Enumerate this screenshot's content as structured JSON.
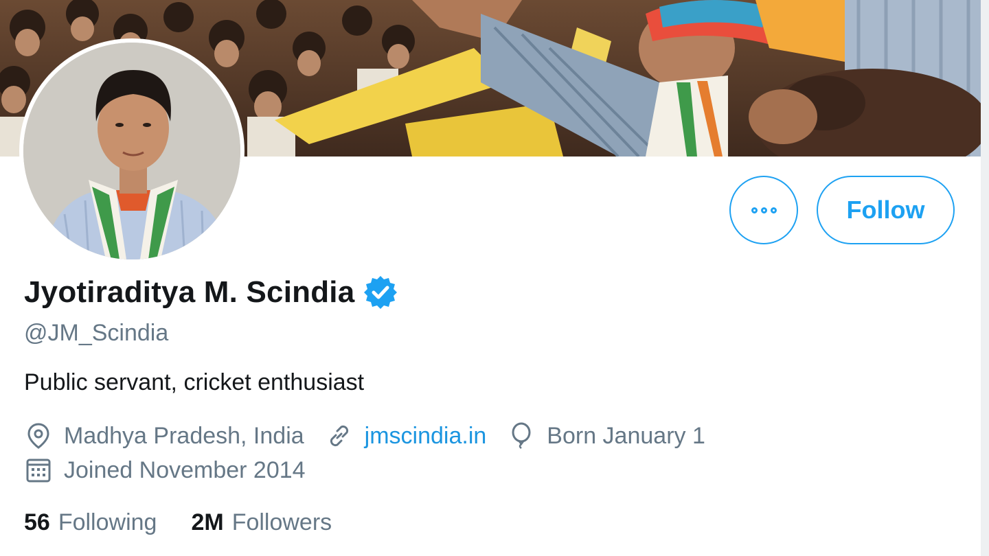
{
  "colors": {
    "accent": "#1da1f2",
    "link": "#1b95e0",
    "secondary_text": "#657786",
    "primary_text": "#14171a"
  },
  "profile": {
    "display_name": "Jyotiraditya M. Scindia",
    "handle": "@JM_Scindia",
    "bio": "Public servant, cricket enthusiast",
    "verified_icon": "verified-badge-icon"
  },
  "actions": {
    "more_icon": "more-options-icon",
    "follow_label": "Follow"
  },
  "meta": {
    "location": "Madhya Pradesh, India",
    "website": "jmscindia.in",
    "birthday": "Born January 1",
    "joined": "Joined November 2014"
  },
  "stats": {
    "following_count": "56",
    "following_label": "Following",
    "followers_count": "2M",
    "followers_label": "Followers"
  }
}
